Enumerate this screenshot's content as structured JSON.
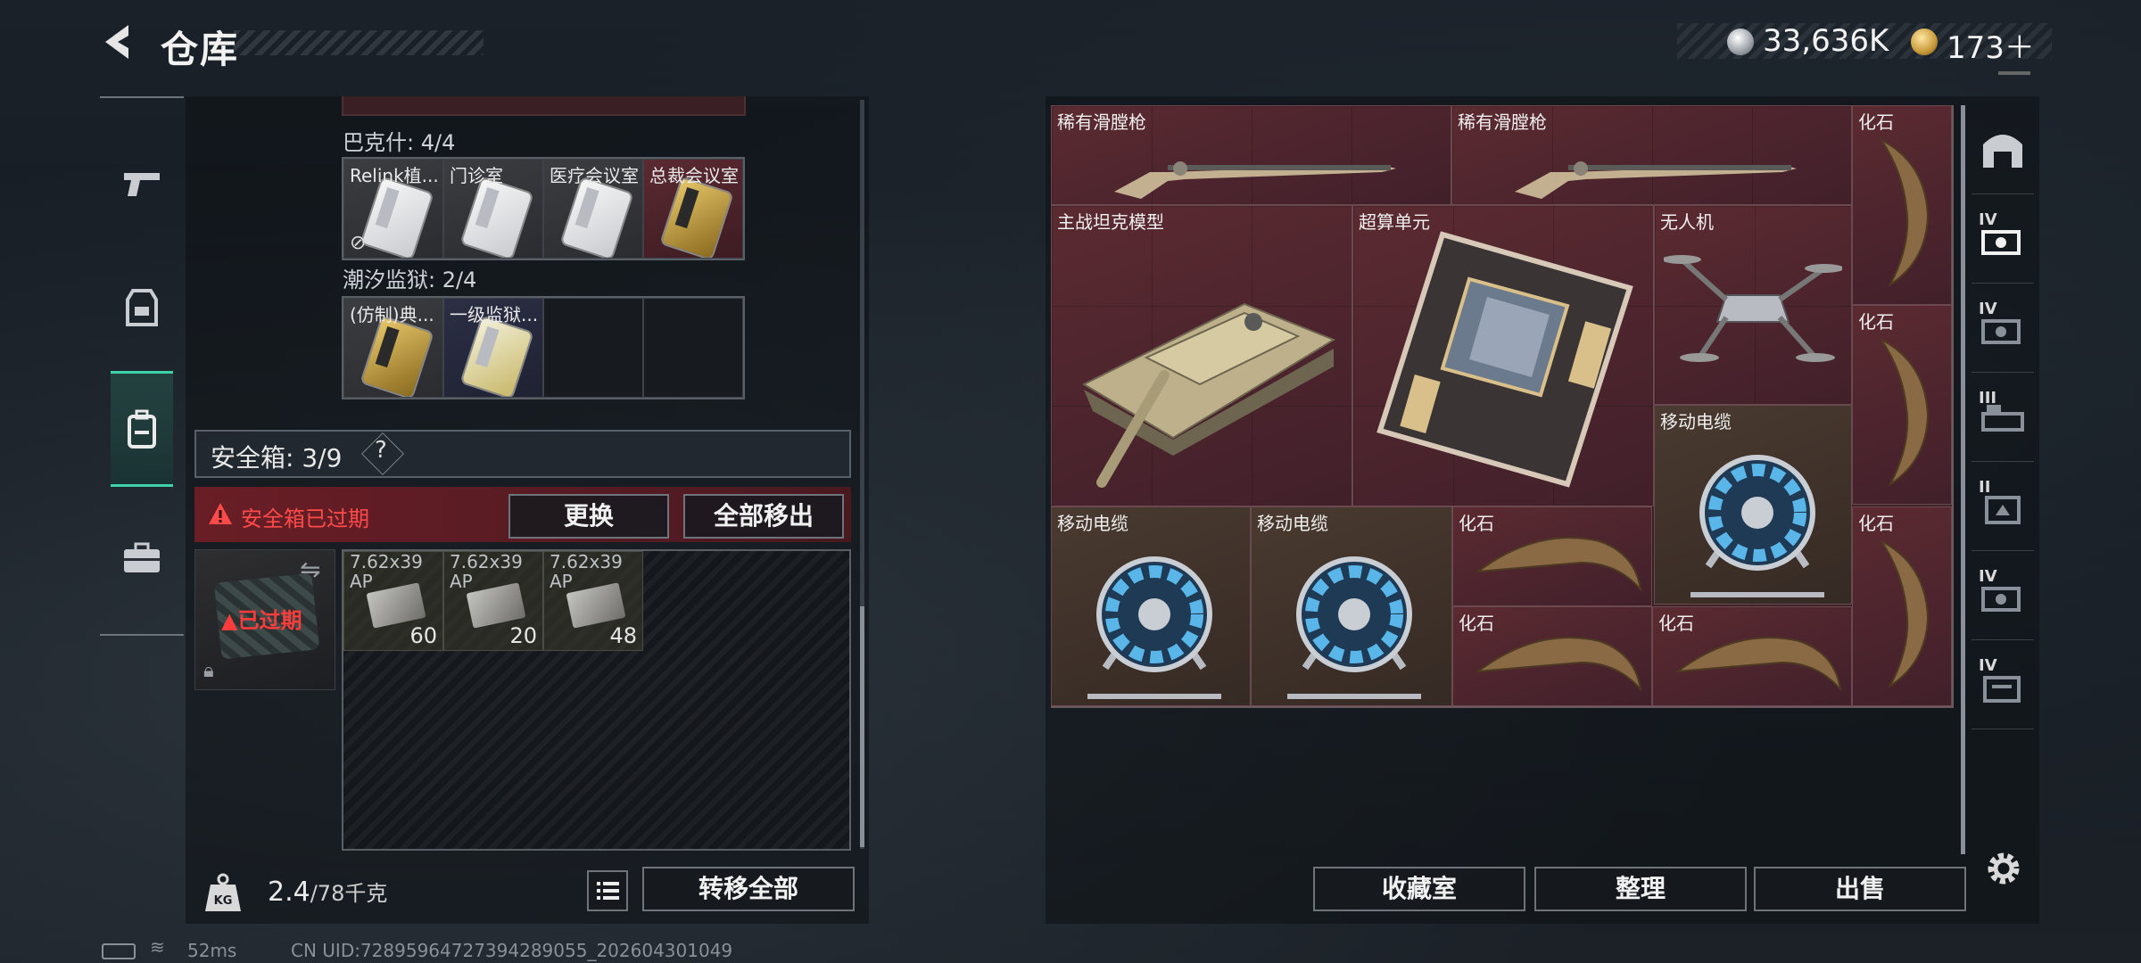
{
  "header": {
    "title": "仓库",
    "currency_1": "33,636K",
    "currency_2": "173＋"
  },
  "left_nav": {
    "items": [
      "weapon",
      "armor",
      "backpack",
      "case"
    ],
    "active": "backpack"
  },
  "keys": {
    "barks_label": "巴克什: 4/4",
    "barks_items": [
      "Relink植...",
      "门诊室",
      "医疗会议室",
      "总裁会议室"
    ],
    "tides_label": "潮汐监狱: 2/4",
    "tides_items": [
      "(仿制)典...",
      "一级监狱..."
    ]
  },
  "safe_box": {
    "label": "安全箱: 3/9",
    "help": "?",
    "expired_text": "安全箱已过期",
    "replace_btn": "更换",
    "move_all_btn": "全部移出",
    "item_expired_tag": "已过期",
    "ammo": [
      {
        "name": "7.62x39",
        "sub": "AP",
        "count": "60"
      },
      {
        "name": "7.62x39",
        "sub": "AP",
        "count": "20"
      },
      {
        "name": "7.62x39",
        "sub": "AP",
        "count": "48"
      }
    ]
  },
  "bottom_left": {
    "weight": "2.4",
    "weight_max": "/78千克",
    "transfer_all_btn": "转移全部",
    "kg": "KG"
  },
  "status": {
    "ping": "52ms",
    "uid": "CN UID:72895964727394289055_202604301049"
  },
  "stash": {
    "items": {
      "rifle_1": "稀有滑膛枪",
      "rifle_2": "稀有滑膛枪",
      "fossil_1": "化石",
      "tank": "主战坦克模型",
      "chip": "超算单元",
      "drone": "无人机",
      "fossil_2": "化石",
      "cable_1": "移动电缆",
      "cable_2": "移动电缆",
      "cable_3": "移动电缆",
      "fossil_3": "化石",
      "fossil_4": "化石",
      "fossil_5": "化石",
      "fossil_6": "化石"
    },
    "collection_btn": "收藏室",
    "sort_btn": "整理",
    "sell_btn": "出售"
  },
  "right_tabs": {
    "levels": [
      "",
      "IV",
      "IV",
      "III",
      "II",
      "IV",
      "IV"
    ]
  },
  "colors": {
    "accent": "#3fd1a8",
    "danger": "#ff4a4a",
    "stash_bg": "#3c2429"
  }
}
